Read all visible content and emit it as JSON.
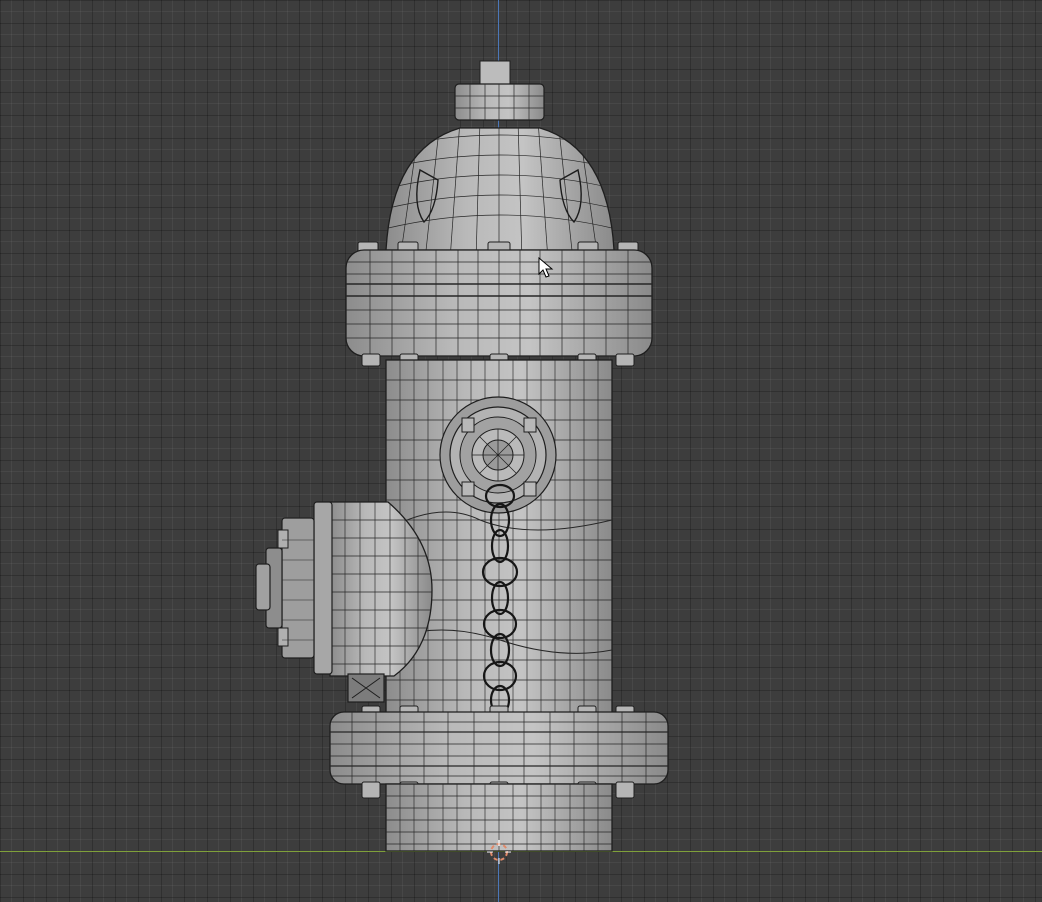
{
  "app": "3D viewport",
  "view": {
    "mode": "wireframe-overlay",
    "grid": true,
    "axes": [
      "x",
      "z"
    ],
    "colors": {
      "background": "#3d3d3d",
      "grid_major": "#2f2f2f",
      "axis_z": "#4b77b8",
      "axis_x": "#7fa03a",
      "mesh_fill": "#a9a9a9",
      "mesh_wire": "#1e1e1e",
      "origin_marker": "#e08a6a"
    }
  },
  "object": {
    "name_icon": "fire-hydrant-mesh",
    "parts": [
      "top-nut",
      "bonnet-dome",
      "upper-flange",
      "barrel",
      "steamer-nozzle",
      "side-nozzle",
      "chain",
      "lower-flange",
      "base"
    ]
  },
  "icons": {
    "cursor": "mouse-pointer-icon",
    "origin": "3d-cursor-icon"
  }
}
